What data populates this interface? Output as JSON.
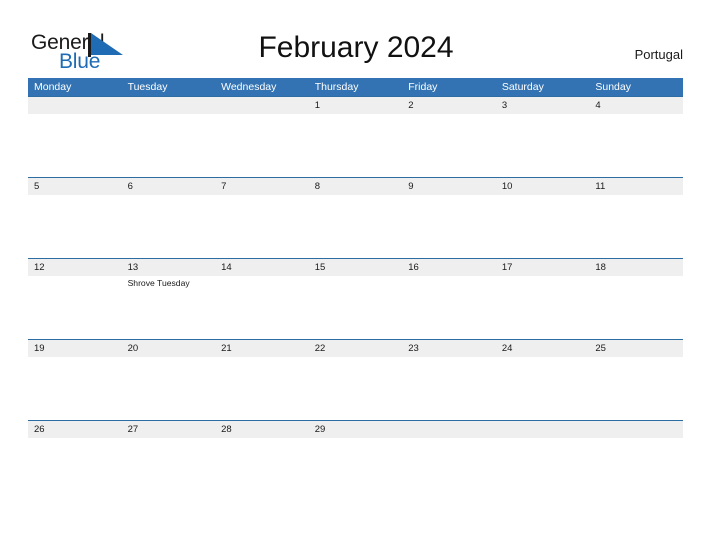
{
  "header": {
    "logo": {
      "text_primary": "General",
      "text_secondary": "Blue",
      "icon": "triangle-flag-icon",
      "primary_color": "#1a1a1a",
      "secondary_color": "#1f6cb5"
    },
    "title": "February 2024",
    "country": "Portugal"
  },
  "calendar": {
    "accent_color": "#3373b3",
    "date_band_color": "#efefef",
    "grid_line_color": "#2e6da4",
    "weekdays": [
      "Monday",
      "Tuesday",
      "Wednesday",
      "Thursday",
      "Friday",
      "Saturday",
      "Sunday"
    ],
    "weeks": [
      {
        "days": [
          {
            "date": "",
            "events": []
          },
          {
            "date": "",
            "events": []
          },
          {
            "date": "",
            "events": []
          },
          {
            "date": "1",
            "events": []
          },
          {
            "date": "2",
            "events": []
          },
          {
            "date": "3",
            "events": []
          },
          {
            "date": "4",
            "events": []
          }
        ]
      },
      {
        "days": [
          {
            "date": "5",
            "events": []
          },
          {
            "date": "6",
            "events": []
          },
          {
            "date": "7",
            "events": []
          },
          {
            "date": "8",
            "events": []
          },
          {
            "date": "9",
            "events": []
          },
          {
            "date": "10",
            "events": []
          },
          {
            "date": "11",
            "events": []
          }
        ]
      },
      {
        "days": [
          {
            "date": "12",
            "events": []
          },
          {
            "date": "13",
            "events": [
              "Shrove Tuesday"
            ]
          },
          {
            "date": "14",
            "events": []
          },
          {
            "date": "15",
            "events": []
          },
          {
            "date": "16",
            "events": []
          },
          {
            "date": "17",
            "events": []
          },
          {
            "date": "18",
            "events": []
          }
        ]
      },
      {
        "days": [
          {
            "date": "19",
            "events": []
          },
          {
            "date": "20",
            "events": []
          },
          {
            "date": "21",
            "events": []
          },
          {
            "date": "22",
            "events": []
          },
          {
            "date": "23",
            "events": []
          },
          {
            "date": "24",
            "events": []
          },
          {
            "date": "25",
            "events": []
          }
        ]
      },
      {
        "days": [
          {
            "date": "26",
            "events": []
          },
          {
            "date": "27",
            "events": []
          },
          {
            "date": "28",
            "events": []
          },
          {
            "date": "29",
            "events": []
          },
          {
            "date": "",
            "events": []
          },
          {
            "date": "",
            "events": []
          },
          {
            "date": "",
            "events": []
          }
        ]
      }
    ]
  }
}
